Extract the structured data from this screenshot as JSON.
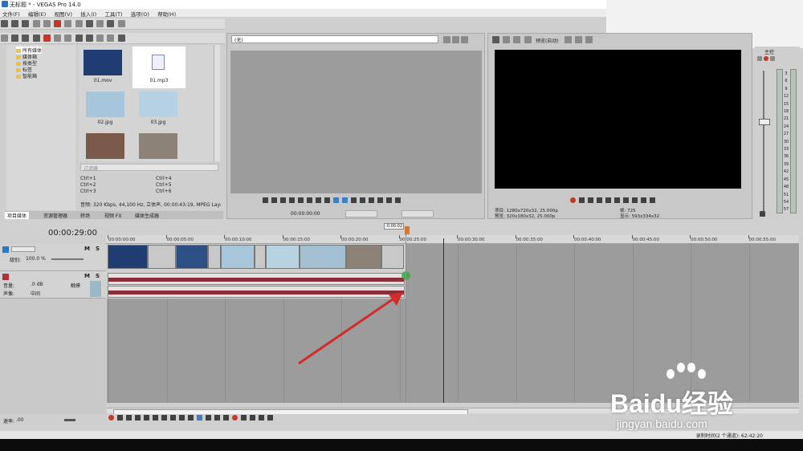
{
  "window": {
    "title": "无标题 * - VEGAS Pro 14.0"
  },
  "menu": [
    "文件(F)",
    "编辑(E)",
    "视图(V)",
    "插入(I)",
    "工具(T)",
    "选项(O)",
    "帮助(H)"
  ],
  "explorer": {
    "tree": [
      "所有媒体",
      "媒体箱",
      "按类型",
      "标签",
      "智能箱"
    ],
    "media": [
      {
        "name": "01.mov"
      },
      {
        "name": "01.mp3"
      },
      {
        "name": "02.jpg"
      },
      {
        "name": "03.jpg"
      },
      {
        "name": ""
      },
      {
        "name": ""
      }
    ],
    "filter_placeholder": "过滤器",
    "shortcuts": [
      "Ctrl+1",
      "Ctrl+4",
      "Ctrl+2",
      "Ctrl+5",
      "Ctrl+3",
      "Ctrl+6"
    ],
    "info": "音频: 320 Kbps, 44,100 Hz, 立体声, 00:00:43:19, MPEG Layer",
    "tabs": [
      "项目媒体",
      "资源管理器",
      "转场",
      "视频 FX",
      "媒体生成器"
    ]
  },
  "trimmer": {
    "dropdown": "(无)",
    "timecode": "00:00:00:00"
  },
  "preview": {
    "dropdown": "预览(自动)",
    "project_label": "项目:",
    "project_value": "1280x720x32, 25.000p",
    "preview_label": "预览:",
    "preview_value": "320x180x32, 25.000p",
    "frame_label": "帧:",
    "frame_value": "725",
    "display_label": "显示:",
    "display_value": "593x334x32"
  },
  "mixer": {
    "label": "主控",
    "scale": [
      "3",
      "6",
      "9",
      "12",
      "15",
      "18",
      "21",
      "24",
      "27",
      "30",
      "33",
      "36",
      "39",
      "42",
      "45",
      "48",
      "51",
      "54",
      "57"
    ]
  },
  "timeline": {
    "timecode": "00:00:29:00",
    "loop_marker": "-0:00:02",
    "ruler": [
      "00:00:00:00",
      "00:00:05:00",
      "00:00:10:00",
      "00:00:15:00",
      "00:00:20:00",
      "00:00:25:00",
      "00:00:30:00",
      "00:00:35:00",
      "00:00:40:00",
      "00:00:45:00",
      "00:00:50:00",
      "00:00:55:00"
    ],
    "video_track": {
      "level_label": "级别:",
      "level_value": "100.0 %"
    },
    "audio_track": {
      "vol_label": "音量:",
      "vol_value": ".0 dB",
      "pan_label": "声像:",
      "pan_value": "中间",
      "mode": "触摸"
    }
  },
  "bottom": {
    "rate_label": "速率:",
    "rate_value": ".00"
  },
  "status": {
    "text": "录制时间(2 个通道): 62:42:20"
  },
  "watermark": {
    "brand": "Baidu经验",
    "url": "jingyan.baidu.com"
  },
  "colors": {
    "accent": "#2a77c9",
    "waveform": "#8b2e3a",
    "arrow": "#d22b2b",
    "playhead_end": "#d9772f"
  }
}
